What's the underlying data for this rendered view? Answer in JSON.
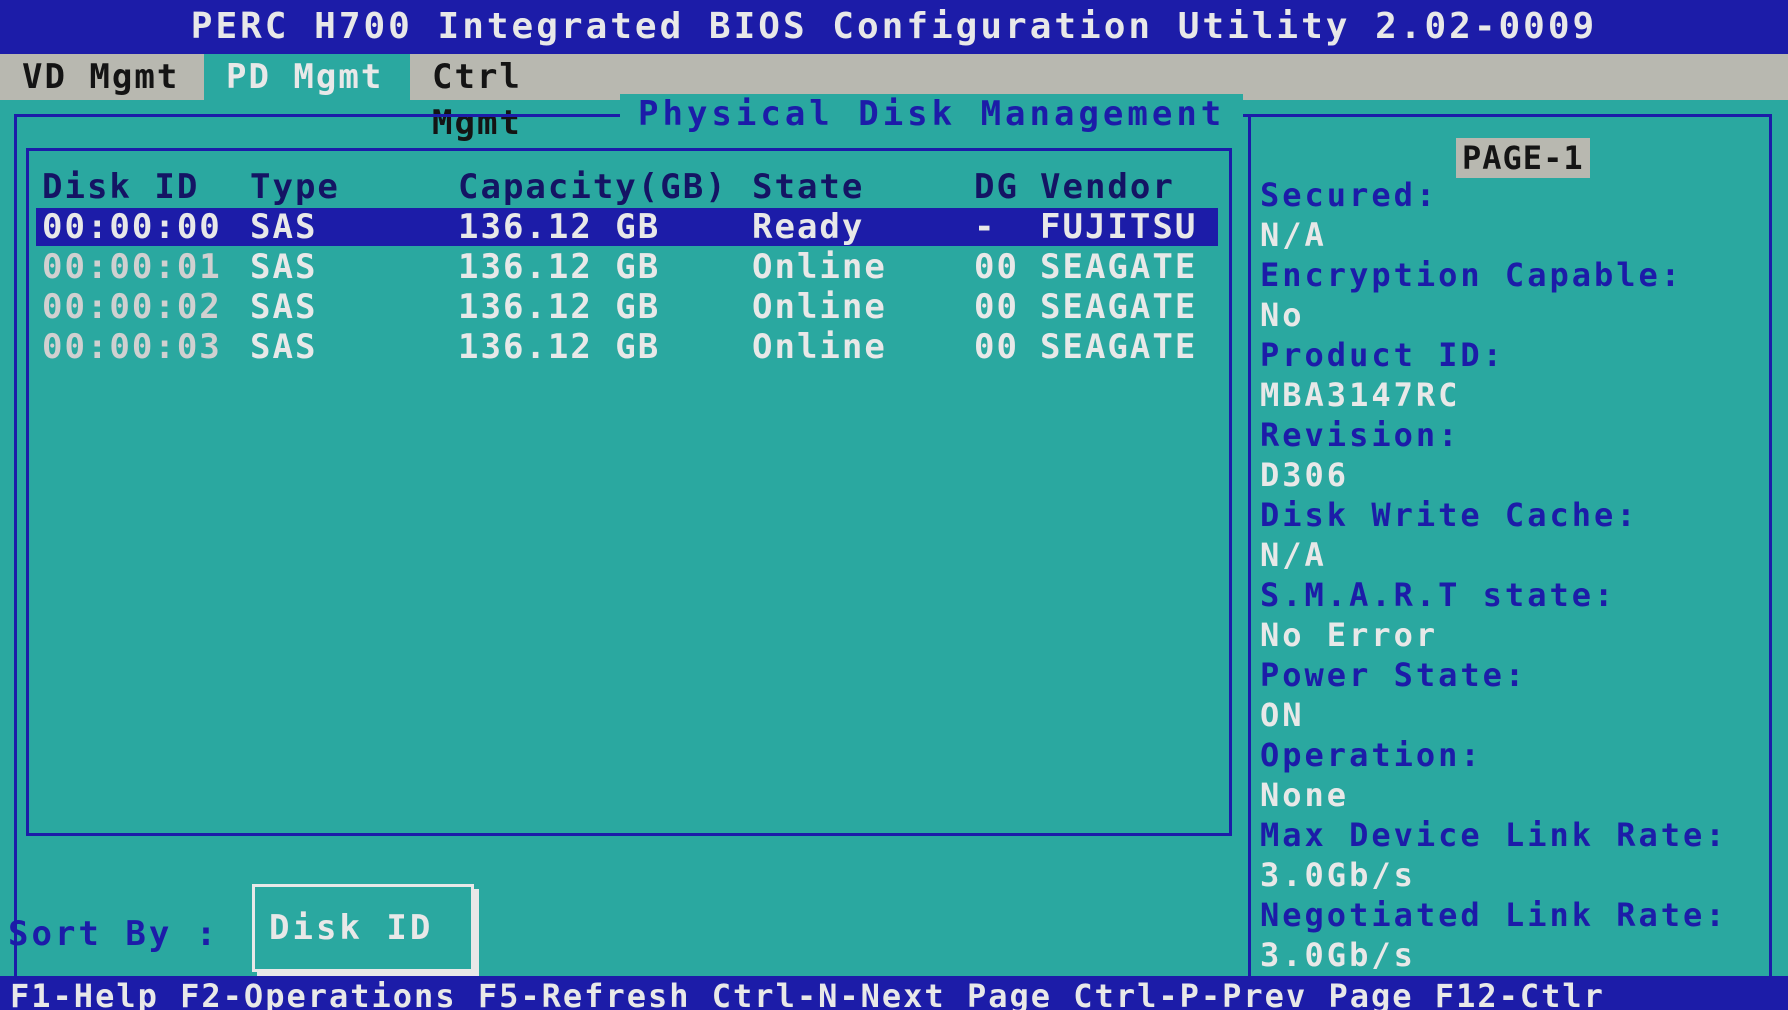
{
  "title": "PERC H700 Integrated BIOS Configuration Utility 2.02-0009",
  "menu": {
    "tabs": [
      {
        "label": "VD Mgmt"
      },
      {
        "label": "PD Mgmt"
      },
      {
        "label": "Ctrl Mgmt"
      }
    ],
    "active_tab": "PD Mgmt"
  },
  "panel": {
    "title": "Physical Disk Management"
  },
  "table": {
    "headers": [
      "Disk ID",
      "Type",
      "Capacity(GB)",
      "State",
      "DG",
      "Vendor"
    ],
    "rows": [
      {
        "disk_id": "00:00:00",
        "type": "SAS",
        "capacity": "136.12 GB",
        "state": "Ready",
        "dg": "-",
        "vendor": "FUJITSU"
      },
      {
        "disk_id": "00:00:01",
        "type": "SAS",
        "capacity": "136.12 GB",
        "state": "Online",
        "dg": "00",
        "vendor": "SEAGATE"
      },
      {
        "disk_id": "00:00:02",
        "type": "SAS",
        "capacity": "136.12 GB",
        "state": "Online",
        "dg": "00",
        "vendor": "SEAGATE"
      },
      {
        "disk_id": "00:00:03",
        "type": "SAS",
        "capacity": "136.12 GB",
        "state": "Online",
        "dg": "00",
        "vendor": "SEAGATE"
      }
    ],
    "selected_row": 0
  },
  "sort": {
    "label": "Sort By :",
    "value": "Disk ID"
  },
  "details": {
    "page": "PAGE-1",
    "items": [
      {
        "label": "Secured:",
        "value": "N/A"
      },
      {
        "label": "Encryption Capable:",
        "value": "No"
      },
      {
        "label": "Product ID:",
        "value": "MBA3147RC"
      },
      {
        "label": "Revision:",
        "value": "D306"
      },
      {
        "label": "Disk Write Cache:",
        "value": "N/A"
      },
      {
        "label": "S.M.A.R.T state:",
        "value": "No Error"
      },
      {
        "label": "Power State:",
        "value": "ON"
      },
      {
        "label": "Operation:",
        "value": "None"
      },
      {
        "label": "Max Device Link Rate:",
        "value": "3.0Gb/s"
      },
      {
        "label": "Negotiated Link Rate:",
        "value": "3.0Gb/s"
      }
    ]
  },
  "footer": {
    "text": "F1-Help F2-Operations F5-Refresh Ctrl-N-Next Page Ctrl-P-Prev Page F12-Ctlr"
  },
  "colors": {
    "background": "#2aa8a0",
    "highlight": "#1c1ca8",
    "menubar": "#b8b8b0",
    "text": "#e8e8e8"
  }
}
